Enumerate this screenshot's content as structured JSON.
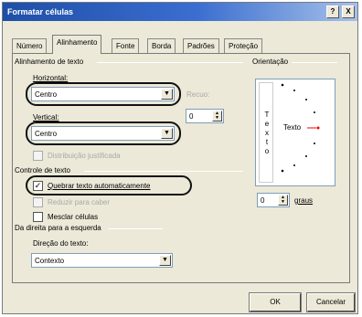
{
  "window": {
    "title": "Formatar células",
    "help_label": "?",
    "close_label": "X"
  },
  "tabs": [
    {
      "label": "Número",
      "active": false
    },
    {
      "label": "Alinhamento",
      "active": true
    },
    {
      "label": "Fonte",
      "active": false
    },
    {
      "label": "Borda",
      "active": false
    },
    {
      "label": "Padrões",
      "active": false
    },
    {
      "label": "Proteção",
      "active": false
    }
  ],
  "text_alignment": {
    "heading": "Alinhamento de texto",
    "horizontal_label": "Horizontal:",
    "horizontal_value": "Centro",
    "vertical_label": "Vertical:",
    "vertical_value": "Centro",
    "indent_label": "Recuo:",
    "indent_value": "0",
    "distributed_label": "Distribuição justificada"
  },
  "orientation": {
    "heading": "Orientação",
    "vertical_text": "Texto",
    "horizontal_text": "Texto",
    "degrees_value": "0",
    "degrees_label": "graus"
  },
  "text_control": {
    "heading": "Controle de texto",
    "wrap_label": "Quebrar texto automaticamente",
    "wrap_checked": true,
    "shrink_label": "Reduzir para caber",
    "merge_label": "Mesclar células"
  },
  "rtl": {
    "heading": "Da direita para a esquerda",
    "direction_label": "Direção do texto:",
    "direction_value": "Contexto"
  },
  "buttons": {
    "ok": "OK",
    "cancel": "Cancelar"
  }
}
